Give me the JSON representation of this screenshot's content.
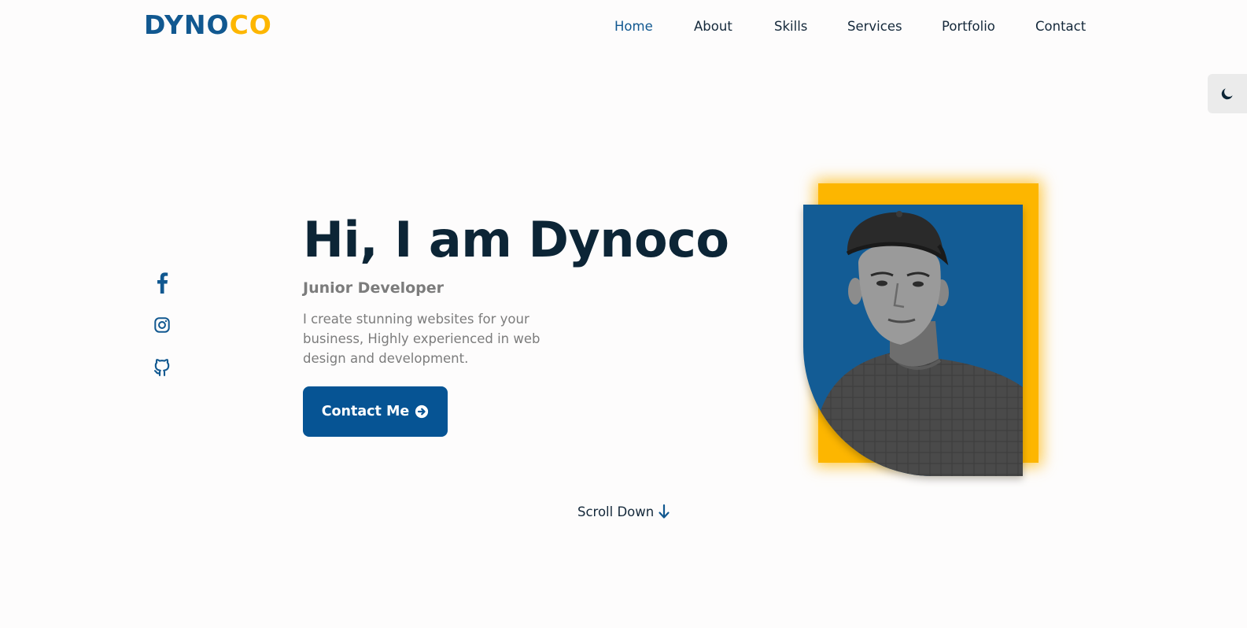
{
  "brand": {
    "part1": "DYNO",
    "part2": "CO"
  },
  "nav": {
    "items": [
      {
        "label": "Home",
        "active": true
      },
      {
        "label": "About",
        "active": false
      },
      {
        "label": "Skills",
        "active": false
      },
      {
        "label": "Services",
        "active": false
      },
      {
        "label": "Portfolio",
        "active": false
      },
      {
        "label": "Contact",
        "active": false
      }
    ]
  },
  "theme_toggle": {
    "icon": "moon-icon"
  },
  "social": [
    {
      "name": "facebook-icon"
    },
    {
      "name": "instagram-icon"
    },
    {
      "name": "github-icon"
    }
  ],
  "hero": {
    "title": "Hi, I am Dynoco",
    "subtitle": "Junior Developer",
    "description": "I create stunning websites for your business, Highly experienced in web design and development.",
    "cta_label": "Contact Me",
    "cta_icon": "arrow-right-circle-icon"
  },
  "scroll": {
    "label": "Scroll Down",
    "icon": "arrow-down-icon"
  },
  "colors": {
    "primary": "#115890",
    "accent": "#fdb600",
    "heading": "#0c2536",
    "muted": "#7c7c7c",
    "background": "#fdfcfc"
  }
}
